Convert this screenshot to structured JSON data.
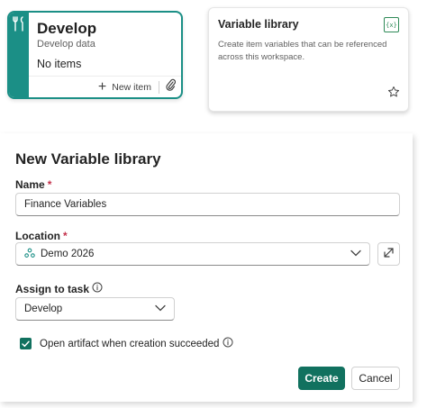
{
  "task_card": {
    "title": "Develop",
    "subtitle": "Develop data",
    "status": "No items",
    "new_item_label": "New item",
    "accent_color": "#1b8f86"
  },
  "library_card": {
    "title": "Variable library",
    "description": "Create item variables that can be referenced across this workspace.",
    "icon_text": "{x}",
    "icon_color": "#2e8a57"
  },
  "dialog": {
    "title": "New Variable library",
    "name_label": "Name",
    "name_value": "Finance Variables",
    "location_label": "Location",
    "location_value": "Demo 2026",
    "assign_label": "Assign to task",
    "assign_value": "Develop",
    "checkbox_label": "Open artifact when creation succeeded",
    "checkbox_checked": true,
    "required_marker": "*",
    "create_label": "Create",
    "cancel_label": "Cancel",
    "primary_color": "#11715f"
  }
}
